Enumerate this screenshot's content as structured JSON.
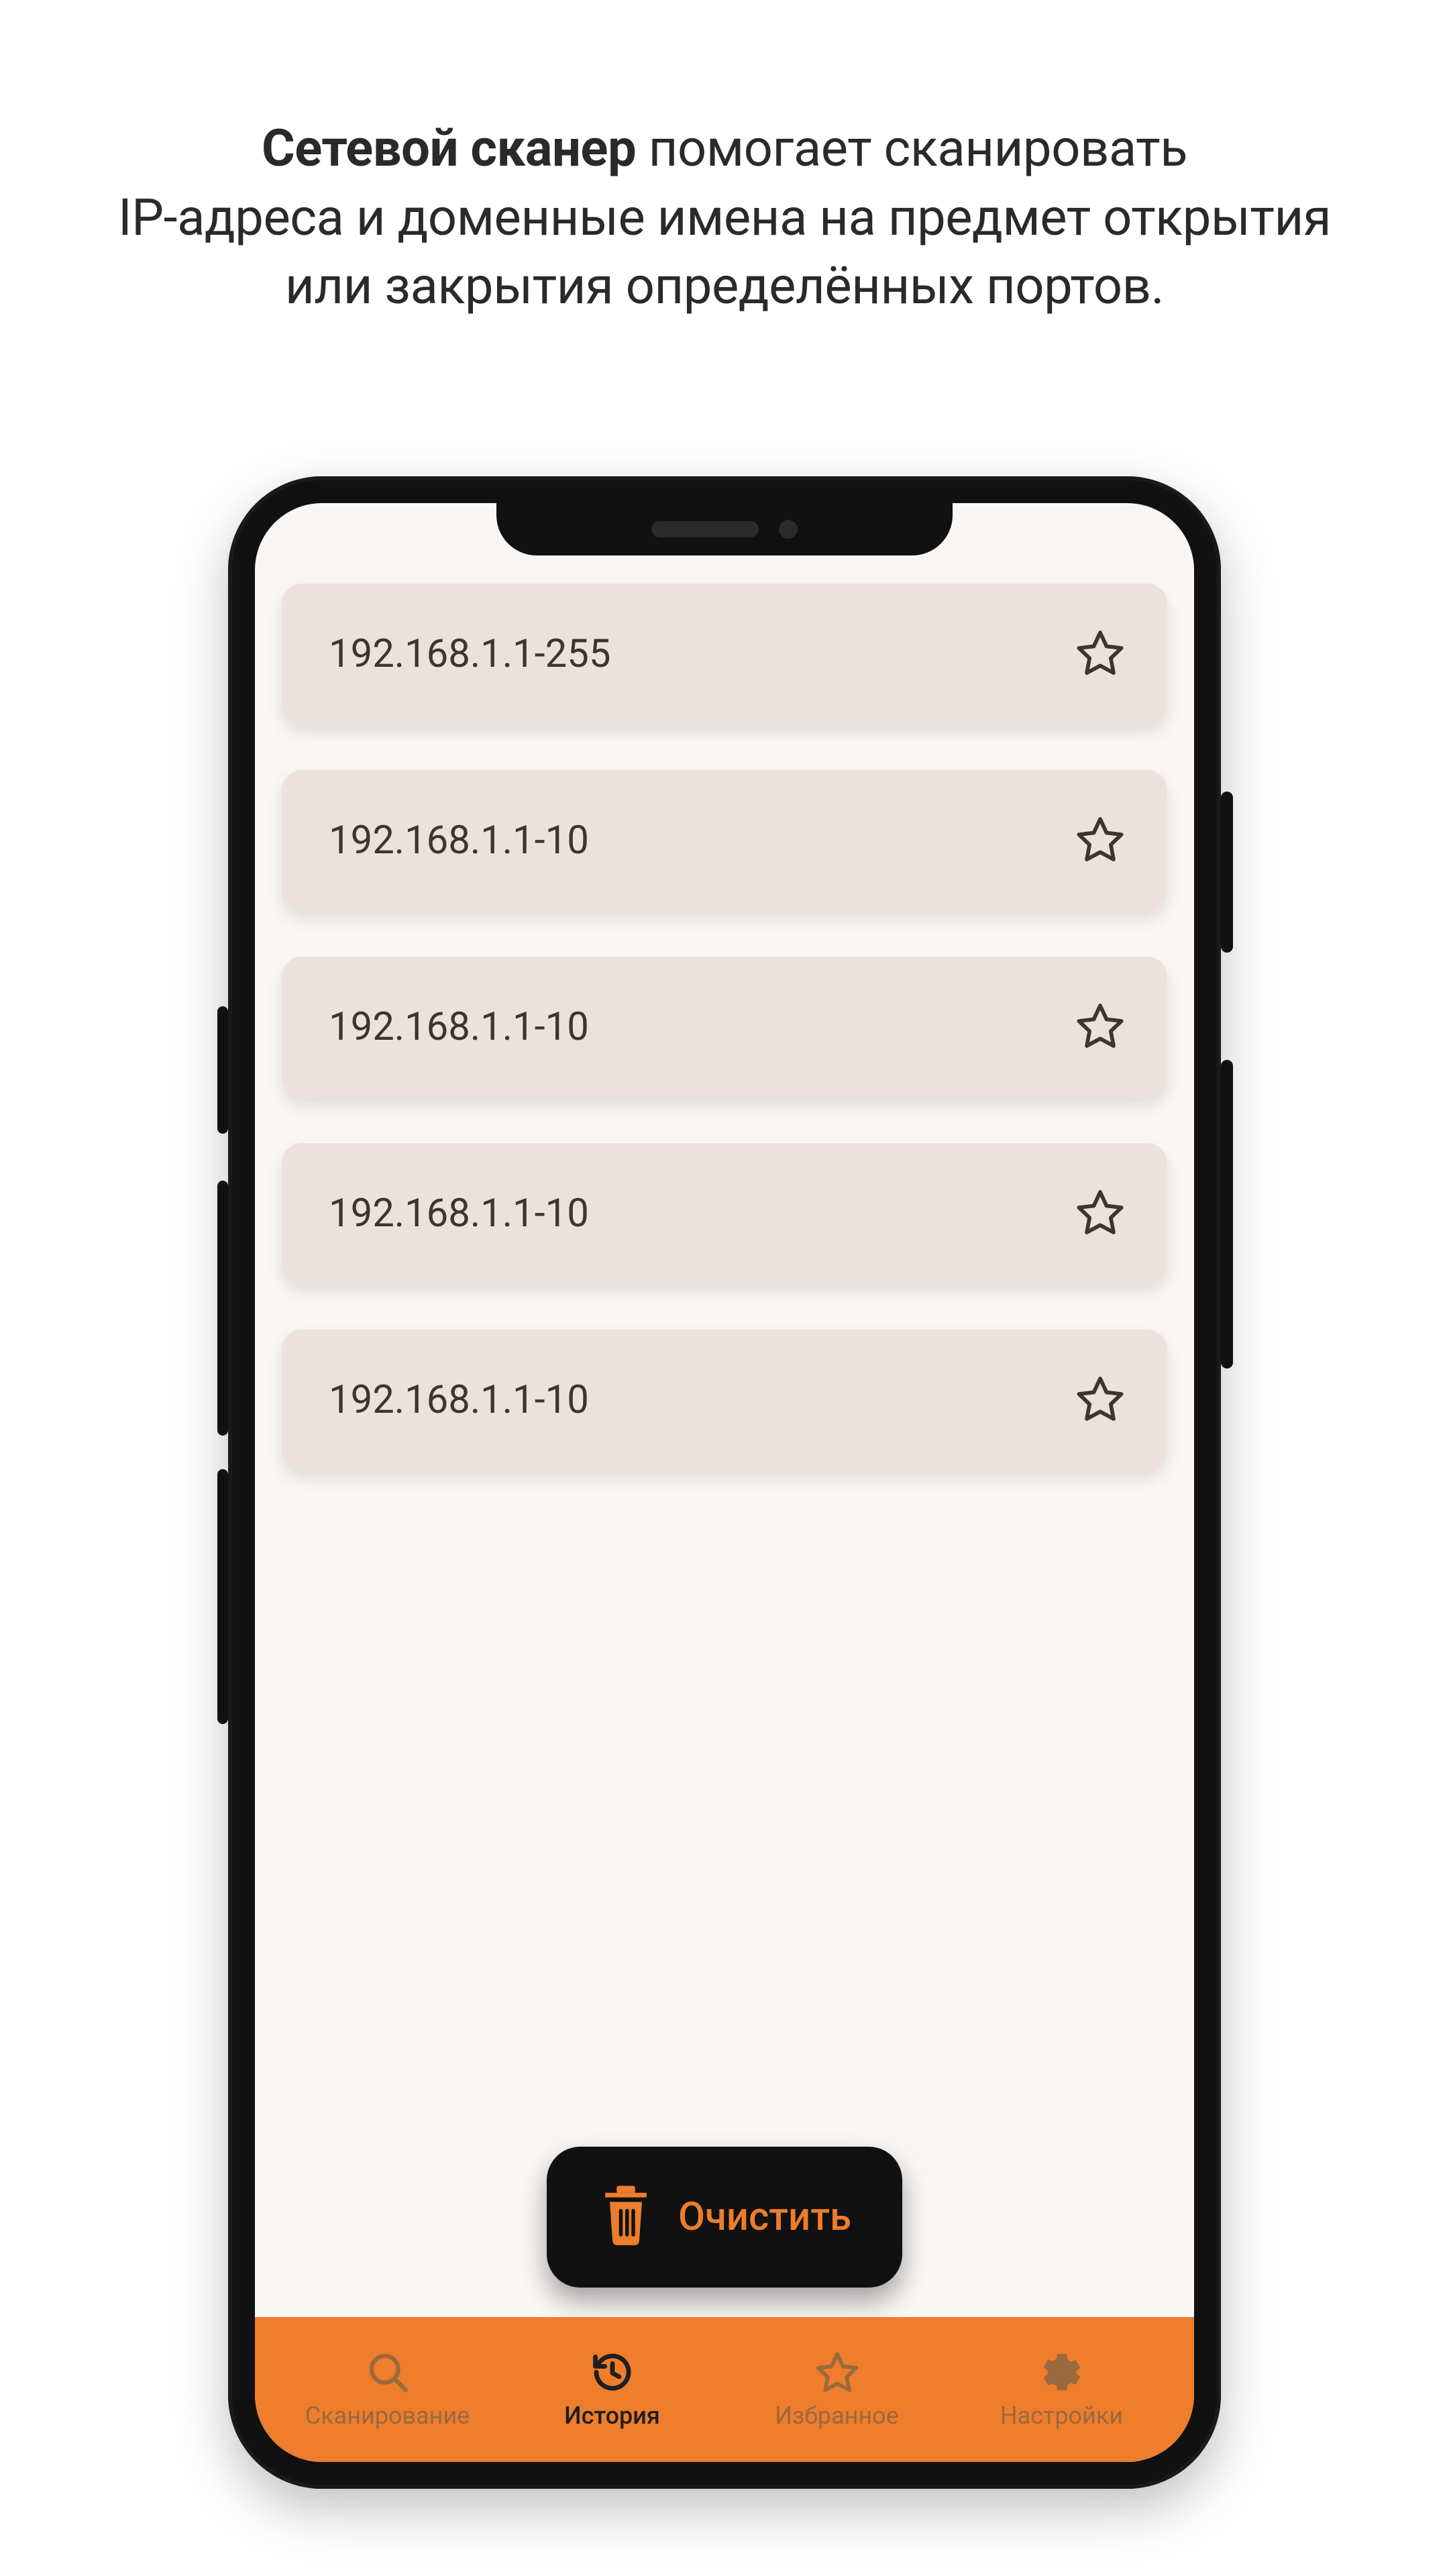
{
  "headline": {
    "bold": "Сетевой сканер",
    "rest_line1": " помогает сканировать",
    "line2": "IP-адреса и доменные имена на предмет открытия",
    "line3": "или закрытия определённых портов."
  },
  "history": {
    "items": [
      {
        "ip": "192.168.1.1-255",
        "favorite": false
      },
      {
        "ip": "192.168.1.1-10",
        "favorite": false
      },
      {
        "ip": "192.168.1.1-10",
        "favorite": false
      },
      {
        "ip": "192.168.1.1-10",
        "favorite": false
      },
      {
        "ip": "192.168.1.1-10",
        "favorite": false
      }
    ]
  },
  "clear_button": {
    "label": "Очистить"
  },
  "nav": {
    "items": [
      {
        "id": "scan",
        "label": "Сканирование",
        "icon": "search-icon",
        "active": false
      },
      {
        "id": "history",
        "label": "История",
        "icon": "history-icon",
        "active": true
      },
      {
        "id": "favorites",
        "label": "Избранное",
        "icon": "star-icon",
        "active": false
      },
      {
        "id": "settings",
        "label": "Настройки",
        "icon": "gear-icon",
        "active": false
      }
    ]
  },
  "colors": {
    "accent": "#ee7d2c",
    "card_bg": "#ece1dd",
    "screen_bg": "#f9f6f4",
    "text_dark": "#3b362f"
  }
}
